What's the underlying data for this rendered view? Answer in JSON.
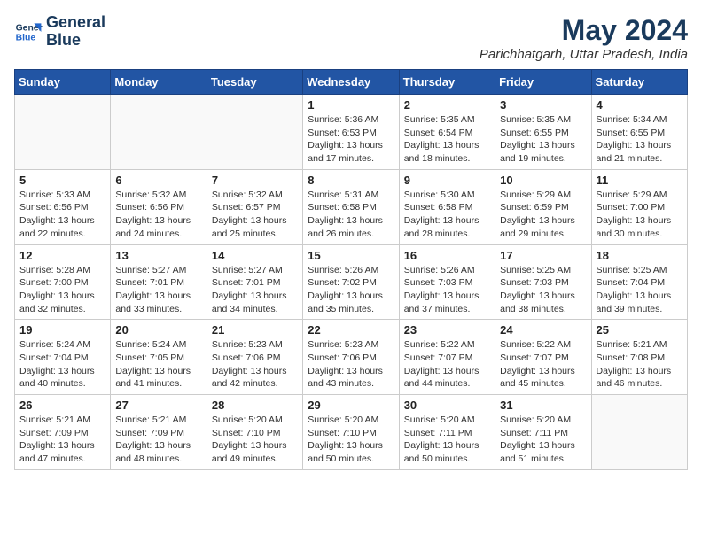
{
  "logo": {
    "line1": "General",
    "line2": "Blue"
  },
  "title": "May 2024",
  "location": "Parichhatgarh, Uttar Pradesh, India",
  "headers": [
    "Sunday",
    "Monday",
    "Tuesday",
    "Wednesday",
    "Thursday",
    "Friday",
    "Saturday"
  ],
  "weeks": [
    [
      {
        "day": "",
        "info": ""
      },
      {
        "day": "",
        "info": ""
      },
      {
        "day": "",
        "info": ""
      },
      {
        "day": "1",
        "info": "Sunrise: 5:36 AM\nSunset: 6:53 PM\nDaylight: 13 hours\nand 17 minutes."
      },
      {
        "day": "2",
        "info": "Sunrise: 5:35 AM\nSunset: 6:54 PM\nDaylight: 13 hours\nand 18 minutes."
      },
      {
        "day": "3",
        "info": "Sunrise: 5:35 AM\nSunset: 6:55 PM\nDaylight: 13 hours\nand 19 minutes."
      },
      {
        "day": "4",
        "info": "Sunrise: 5:34 AM\nSunset: 6:55 PM\nDaylight: 13 hours\nand 21 minutes."
      }
    ],
    [
      {
        "day": "5",
        "info": "Sunrise: 5:33 AM\nSunset: 6:56 PM\nDaylight: 13 hours\nand 22 minutes."
      },
      {
        "day": "6",
        "info": "Sunrise: 5:32 AM\nSunset: 6:56 PM\nDaylight: 13 hours\nand 24 minutes."
      },
      {
        "day": "7",
        "info": "Sunrise: 5:32 AM\nSunset: 6:57 PM\nDaylight: 13 hours\nand 25 minutes."
      },
      {
        "day": "8",
        "info": "Sunrise: 5:31 AM\nSunset: 6:58 PM\nDaylight: 13 hours\nand 26 minutes."
      },
      {
        "day": "9",
        "info": "Sunrise: 5:30 AM\nSunset: 6:58 PM\nDaylight: 13 hours\nand 28 minutes."
      },
      {
        "day": "10",
        "info": "Sunrise: 5:29 AM\nSunset: 6:59 PM\nDaylight: 13 hours\nand 29 minutes."
      },
      {
        "day": "11",
        "info": "Sunrise: 5:29 AM\nSunset: 7:00 PM\nDaylight: 13 hours\nand 30 minutes."
      }
    ],
    [
      {
        "day": "12",
        "info": "Sunrise: 5:28 AM\nSunset: 7:00 PM\nDaylight: 13 hours\nand 32 minutes."
      },
      {
        "day": "13",
        "info": "Sunrise: 5:27 AM\nSunset: 7:01 PM\nDaylight: 13 hours\nand 33 minutes."
      },
      {
        "day": "14",
        "info": "Sunrise: 5:27 AM\nSunset: 7:01 PM\nDaylight: 13 hours\nand 34 minutes."
      },
      {
        "day": "15",
        "info": "Sunrise: 5:26 AM\nSunset: 7:02 PM\nDaylight: 13 hours\nand 35 minutes."
      },
      {
        "day": "16",
        "info": "Sunrise: 5:26 AM\nSunset: 7:03 PM\nDaylight: 13 hours\nand 37 minutes."
      },
      {
        "day": "17",
        "info": "Sunrise: 5:25 AM\nSunset: 7:03 PM\nDaylight: 13 hours\nand 38 minutes."
      },
      {
        "day": "18",
        "info": "Sunrise: 5:25 AM\nSunset: 7:04 PM\nDaylight: 13 hours\nand 39 minutes."
      }
    ],
    [
      {
        "day": "19",
        "info": "Sunrise: 5:24 AM\nSunset: 7:04 PM\nDaylight: 13 hours\nand 40 minutes."
      },
      {
        "day": "20",
        "info": "Sunrise: 5:24 AM\nSunset: 7:05 PM\nDaylight: 13 hours\nand 41 minutes."
      },
      {
        "day": "21",
        "info": "Sunrise: 5:23 AM\nSunset: 7:06 PM\nDaylight: 13 hours\nand 42 minutes."
      },
      {
        "day": "22",
        "info": "Sunrise: 5:23 AM\nSunset: 7:06 PM\nDaylight: 13 hours\nand 43 minutes."
      },
      {
        "day": "23",
        "info": "Sunrise: 5:22 AM\nSunset: 7:07 PM\nDaylight: 13 hours\nand 44 minutes."
      },
      {
        "day": "24",
        "info": "Sunrise: 5:22 AM\nSunset: 7:07 PM\nDaylight: 13 hours\nand 45 minutes."
      },
      {
        "day": "25",
        "info": "Sunrise: 5:21 AM\nSunset: 7:08 PM\nDaylight: 13 hours\nand 46 minutes."
      }
    ],
    [
      {
        "day": "26",
        "info": "Sunrise: 5:21 AM\nSunset: 7:09 PM\nDaylight: 13 hours\nand 47 minutes."
      },
      {
        "day": "27",
        "info": "Sunrise: 5:21 AM\nSunset: 7:09 PM\nDaylight: 13 hours\nand 48 minutes."
      },
      {
        "day": "28",
        "info": "Sunrise: 5:20 AM\nSunset: 7:10 PM\nDaylight: 13 hours\nand 49 minutes."
      },
      {
        "day": "29",
        "info": "Sunrise: 5:20 AM\nSunset: 7:10 PM\nDaylight: 13 hours\nand 50 minutes."
      },
      {
        "day": "30",
        "info": "Sunrise: 5:20 AM\nSunset: 7:11 PM\nDaylight: 13 hours\nand 50 minutes."
      },
      {
        "day": "31",
        "info": "Sunrise: 5:20 AM\nSunset: 7:11 PM\nDaylight: 13 hours\nand 51 minutes."
      },
      {
        "day": "",
        "info": ""
      }
    ]
  ]
}
